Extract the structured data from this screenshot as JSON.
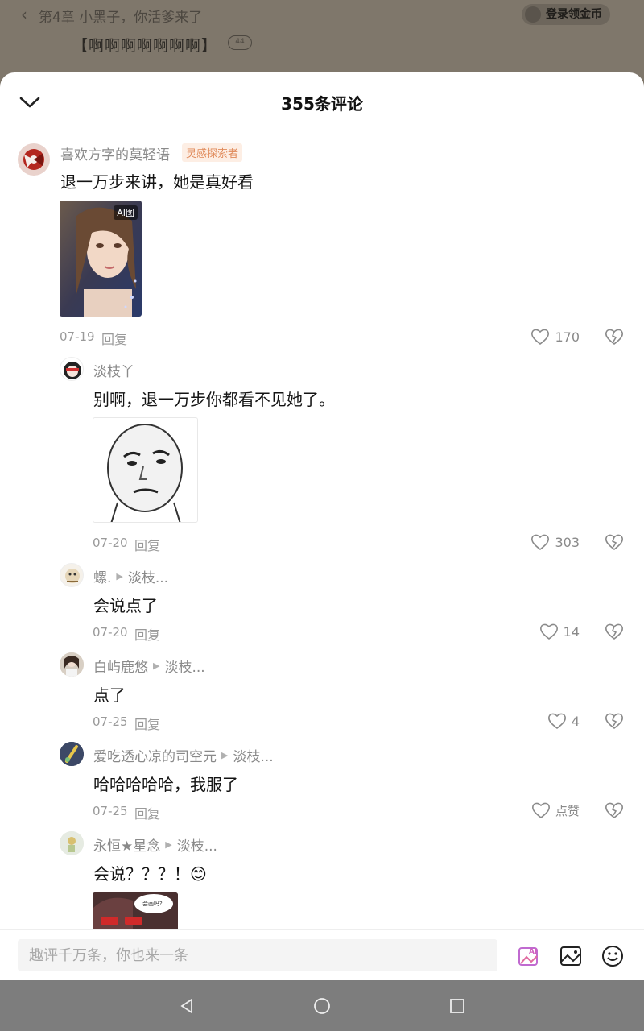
{
  "background": {
    "back_glyph": "‹",
    "chapter_title": "第4章 小黑子，你活爹来了",
    "login_label": "登录领金币",
    "paragraph": "【啊啊啊啊啊啊啊】",
    "paragraph_badge": "44"
  },
  "sheet": {
    "title": "355条评论",
    "collapse_icon": "chevron-down-icon"
  },
  "comments": [
    {
      "username": "喜欢方字的莫轻语",
      "tag": "灵感探索者",
      "text": "退一万步来讲，她是真好看",
      "image_badge": "AI图",
      "date": "07-19",
      "reply_label": "回复",
      "likes": "170"
    },
    {
      "username": "淡枝丫",
      "text": "别啊，退一万步你都看不见她了。",
      "date": "07-20",
      "reply_label": "回复",
      "likes": "303"
    },
    {
      "username": "螺.",
      "reply_to": "淡枝...",
      "text": "会说点了",
      "date": "07-20",
      "reply_label": "回复",
      "likes": "14"
    },
    {
      "username": "白屿鹿悠",
      "reply_to": "淡枝...",
      "text": "点了",
      "date": "07-25",
      "reply_label": "回复",
      "likes": "4"
    },
    {
      "username": "爱吃透心凉的司空元",
      "reply_to": "淡枝...",
      "text": "哈哈哈哈哈，我服了",
      "date": "07-25",
      "reply_label": "回复",
      "likes": "点赞"
    },
    {
      "username": "永恒★星念",
      "reply_to": "淡枝...",
      "text": "会说？？？！😊",
      "sticker_bubble": "会画吗?"
    }
  ],
  "input": {
    "placeholder": "趣评千万条，你也来一条",
    "ai_badge": "AI"
  },
  "colors": {
    "accent": "#e06aa0",
    "tag_text": "#e08a5a",
    "tag_bg": "#fdeee4",
    "dim_overlay": "#7f776b"
  }
}
